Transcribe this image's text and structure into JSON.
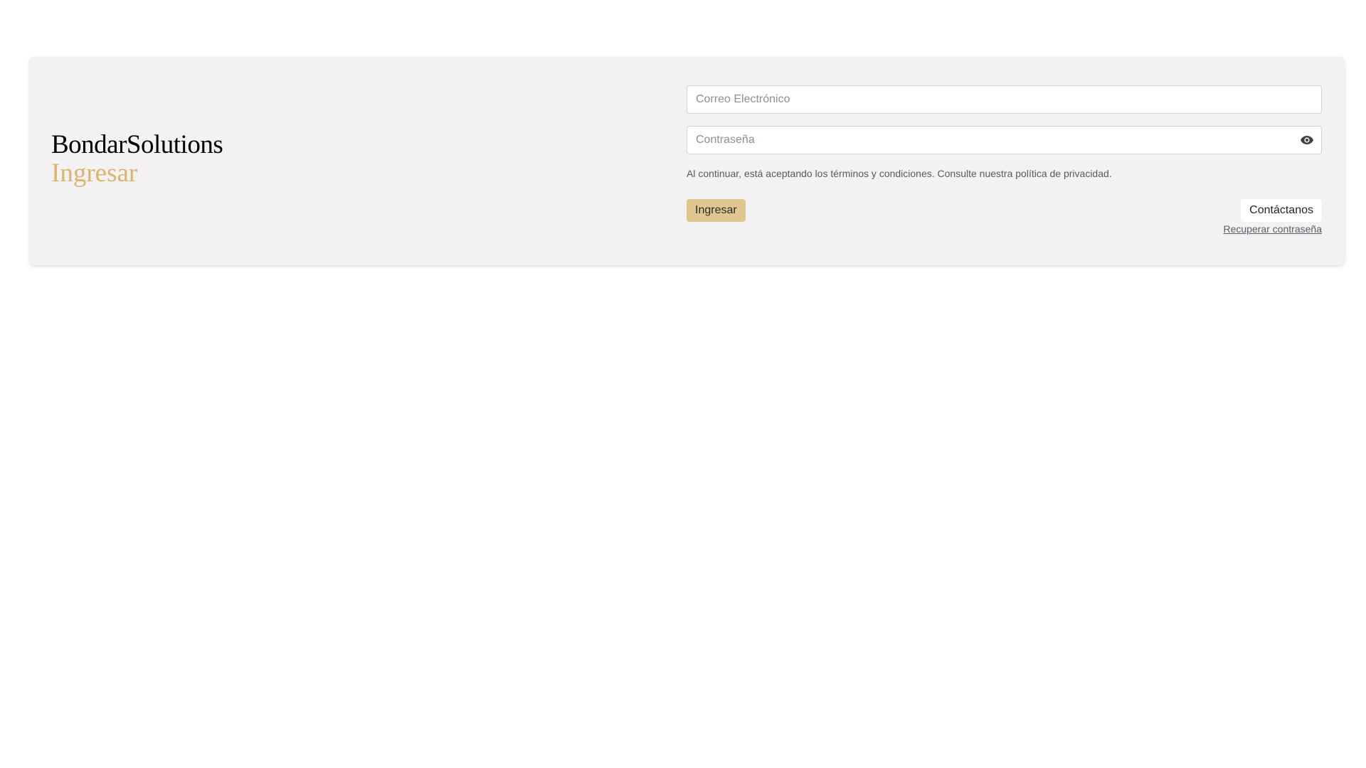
{
  "brand": {
    "name": "BondarSolutions",
    "subtitle": "Ingresar",
    "accent_color": "#d9b56e"
  },
  "form": {
    "email": {
      "placeholder": "Correo Electrónico",
      "value": ""
    },
    "password": {
      "placeholder": "Contraseña",
      "value": "",
      "toggle_icon": "eye-icon"
    },
    "terms_text": "Al continuar, está aceptando los términos y condiciones. Consulte nuestra política de privacidad.",
    "submit_label": "Ingresar",
    "submit_color": "#dfc78f",
    "contact_label": "Contáctanos",
    "recover_label": "Recuperar contraseña"
  }
}
